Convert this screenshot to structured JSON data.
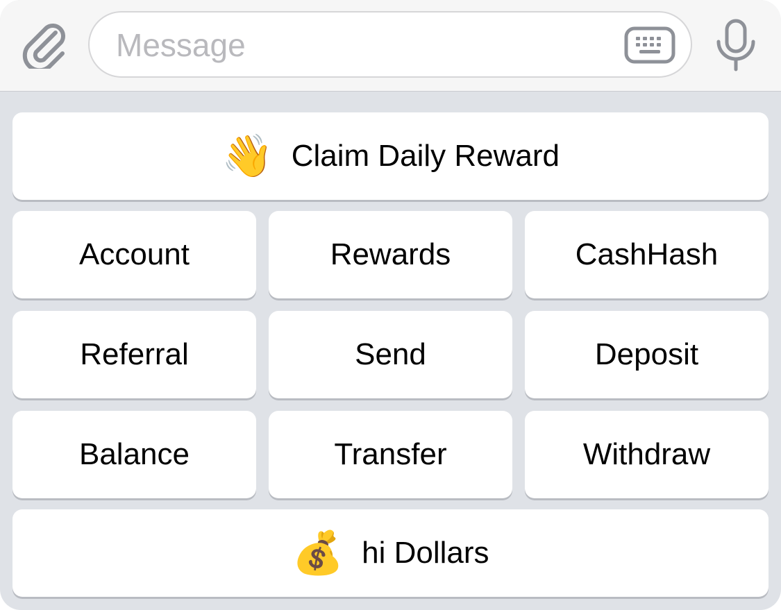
{
  "input_bar": {
    "placeholder": "Message",
    "attach_icon": "paperclip-icon",
    "keyboard_icon": "keyboard-icon",
    "mic_icon": "microphone-icon"
  },
  "keyboard": {
    "claim": {
      "emoji": "👋",
      "label": "Claim Daily Reward"
    },
    "row1": [
      "Account",
      "Rewards",
      "CashHash"
    ],
    "row2": [
      "Referral",
      "Send",
      "Deposit"
    ],
    "row3": [
      "Balance",
      "Transfer",
      "Withdraw"
    ],
    "dollars": {
      "emoji": "💰",
      "label": "hi Dollars"
    }
  },
  "colors": {
    "panel_background": "#dfe2e7",
    "button_background": "#ffffff",
    "icon_gray": "#8e9198"
  }
}
